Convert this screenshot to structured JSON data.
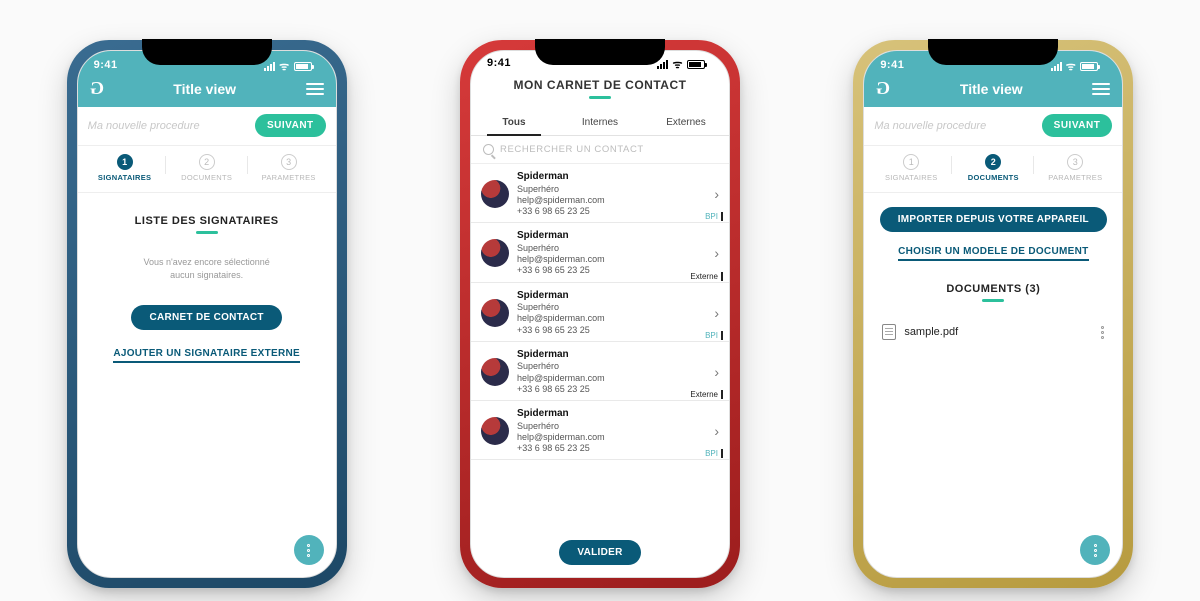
{
  "status": {
    "time": "9:41"
  },
  "common": {
    "title": "Title view",
    "placeholder": "Ma nouvelle procedure",
    "next": "SUIVANT",
    "steps": {
      "s1": {
        "num": "1",
        "label": "SIGNATAIRES"
      },
      "s2": {
        "num": "2",
        "label": "DOCUMENTS"
      },
      "s3": {
        "num": "3",
        "label": "PARAMETRES"
      }
    }
  },
  "phone1": {
    "section_title": "LISTE DES SIGNATAIRES",
    "empty_l1": "Vous n'avez encore sélectionné",
    "empty_l2": "aucun signataires.",
    "btn_contact": "CARNET DE CONTACT",
    "link_ext": "AJOUTER UN SIGNATAIRE EXTERNE"
  },
  "phone2": {
    "title": "MON CARNET DE CONTACT",
    "tabs": {
      "t1": "Tous",
      "t2": "Internes",
      "t3": "Externes"
    },
    "search_ph": "RECHERCHER UN CONTACT",
    "validate": "VALIDER",
    "contacts": [
      {
        "name": "Spiderman",
        "role": "Superhéro",
        "email": "help@spiderman.com",
        "phone": "+33 6 98 65 23 25",
        "tag": "BPI",
        "ext": false
      },
      {
        "name": "Spiderman",
        "role": "Superhéro",
        "email": "help@spiderman.com",
        "phone": "+33 6 98 65 23 25",
        "tag": "Externe",
        "ext": true
      },
      {
        "name": "Spiderman",
        "role": "Superhéro",
        "email": "help@spiderman.com",
        "phone": "+33 6 98 65 23 25",
        "tag": "BPI",
        "ext": false
      },
      {
        "name": "Spiderman",
        "role": "Superhéro",
        "email": "help@spiderman.com",
        "phone": "+33 6 98 65 23 25",
        "tag": "Externe",
        "ext": true
      },
      {
        "name": "Spiderman",
        "role": "Superhéro",
        "email": "help@spiderman.com",
        "phone": "+33 6 98 65 23 25",
        "tag": "BPI",
        "ext": false
      }
    ]
  },
  "phone3": {
    "btn_import": "IMPORTER DEPUIS VOTRE APPAREIL",
    "link_model": "CHOISIR UN MODELE DE DOCUMENT",
    "docs_title": "DOCUMENTS (3)",
    "file": "sample.pdf"
  }
}
